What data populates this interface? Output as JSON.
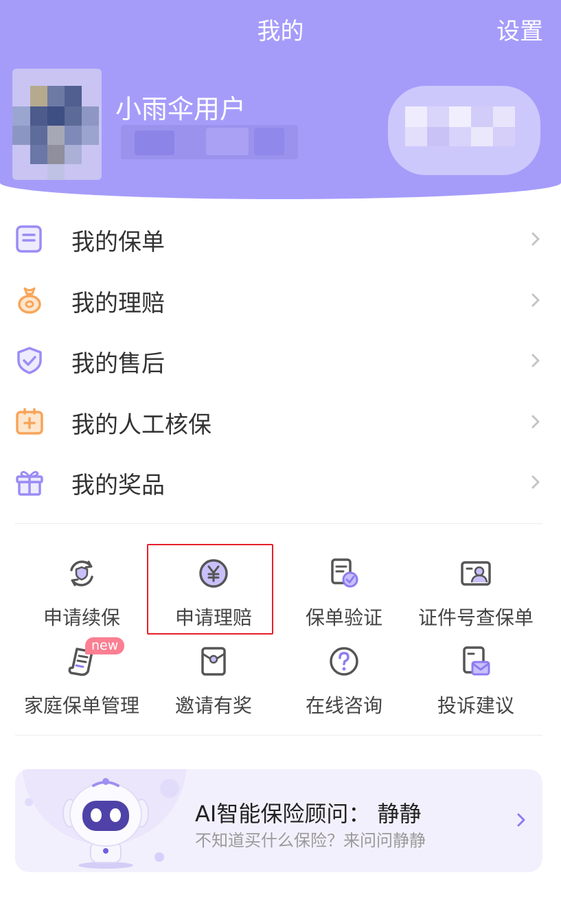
{
  "header": {
    "title": "我的",
    "settings": "设置",
    "username": "小雨伞用户",
    "background": "#a59cfa"
  },
  "menu": [
    {
      "label": "我的保单",
      "icon": "policy-doc-icon"
    },
    {
      "label": "我的理赔",
      "icon": "money-bag-icon"
    },
    {
      "label": "我的售后",
      "icon": "shield-check-icon"
    },
    {
      "label": "我的人工核保",
      "icon": "medical-kit-icon"
    },
    {
      "label": "我的奖品",
      "icon": "gift-icon"
    }
  ],
  "services": [
    {
      "label": "申请续保",
      "icon": "renew-shield-icon"
    },
    {
      "label": "申请理赔",
      "icon": "yen-coin-icon"
    },
    {
      "label": "保单验证",
      "icon": "doc-verify-icon"
    },
    {
      "label": "证件号查保单",
      "icon": "id-card-icon"
    },
    {
      "label": "家庭保单管理",
      "icon": "family-scroll-icon",
      "badge": "new"
    },
    {
      "label": "邀请有奖",
      "icon": "invite-envelope-icon"
    },
    {
      "label": "在线咨询",
      "icon": "question-circle-icon"
    },
    {
      "label": "投诉建议",
      "icon": "complaint-mail-icon"
    }
  ],
  "ai_card": {
    "title": "AI智能保险顾问：  静静",
    "subtitle": "不知道买什么保险？来问问静静",
    "icon": "robot-mascot-icon"
  },
  "colors": {
    "accent": "#8c7cf3",
    "orange": "#f7a55a",
    "highlight_border": "#e4202a",
    "badge": "#fb7f92"
  }
}
